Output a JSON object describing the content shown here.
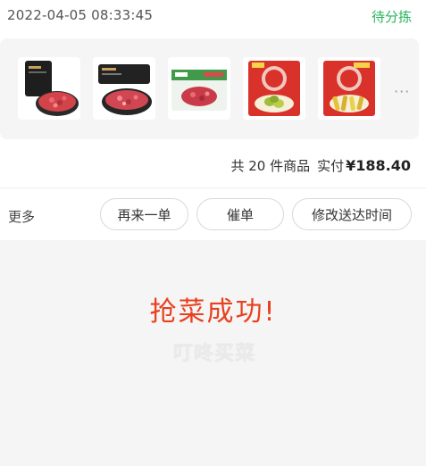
{
  "order": {
    "timestamp": "2022-04-05 08:33:45",
    "status": "待分拣"
  },
  "products": {
    "items": [
      {
        "name": "beef-mince-pack-black",
        "icon": "minced-meat-product-icon"
      },
      {
        "name": "pork-mince-tray",
        "icon": "minced-meat-tray-icon"
      },
      {
        "name": "beef-mince-green-box",
        "icon": "meat-box-icon"
      },
      {
        "name": "pickled-vegetables-red-bag",
        "icon": "pickle-bag-icon"
      },
      {
        "name": "pickled-peppers-red-bag",
        "icon": "pickle-bag-icon"
      }
    ],
    "more_label": "···"
  },
  "summary": {
    "count_text": "共 20 件商品",
    "paid_label": "实付",
    "price": "¥188.40"
  },
  "actions": {
    "more_label": "更多",
    "reorder_label": "再来一单",
    "urge_label": "催单",
    "change_time_label": "修改送达时间"
  },
  "result": {
    "success_text": "抢菜成功!",
    "watermark_text": "叮咚买菜"
  },
  "colors": {
    "status_green": "#27b35b",
    "success_red": "#e8411f",
    "background_grey": "#f5f5f5"
  }
}
